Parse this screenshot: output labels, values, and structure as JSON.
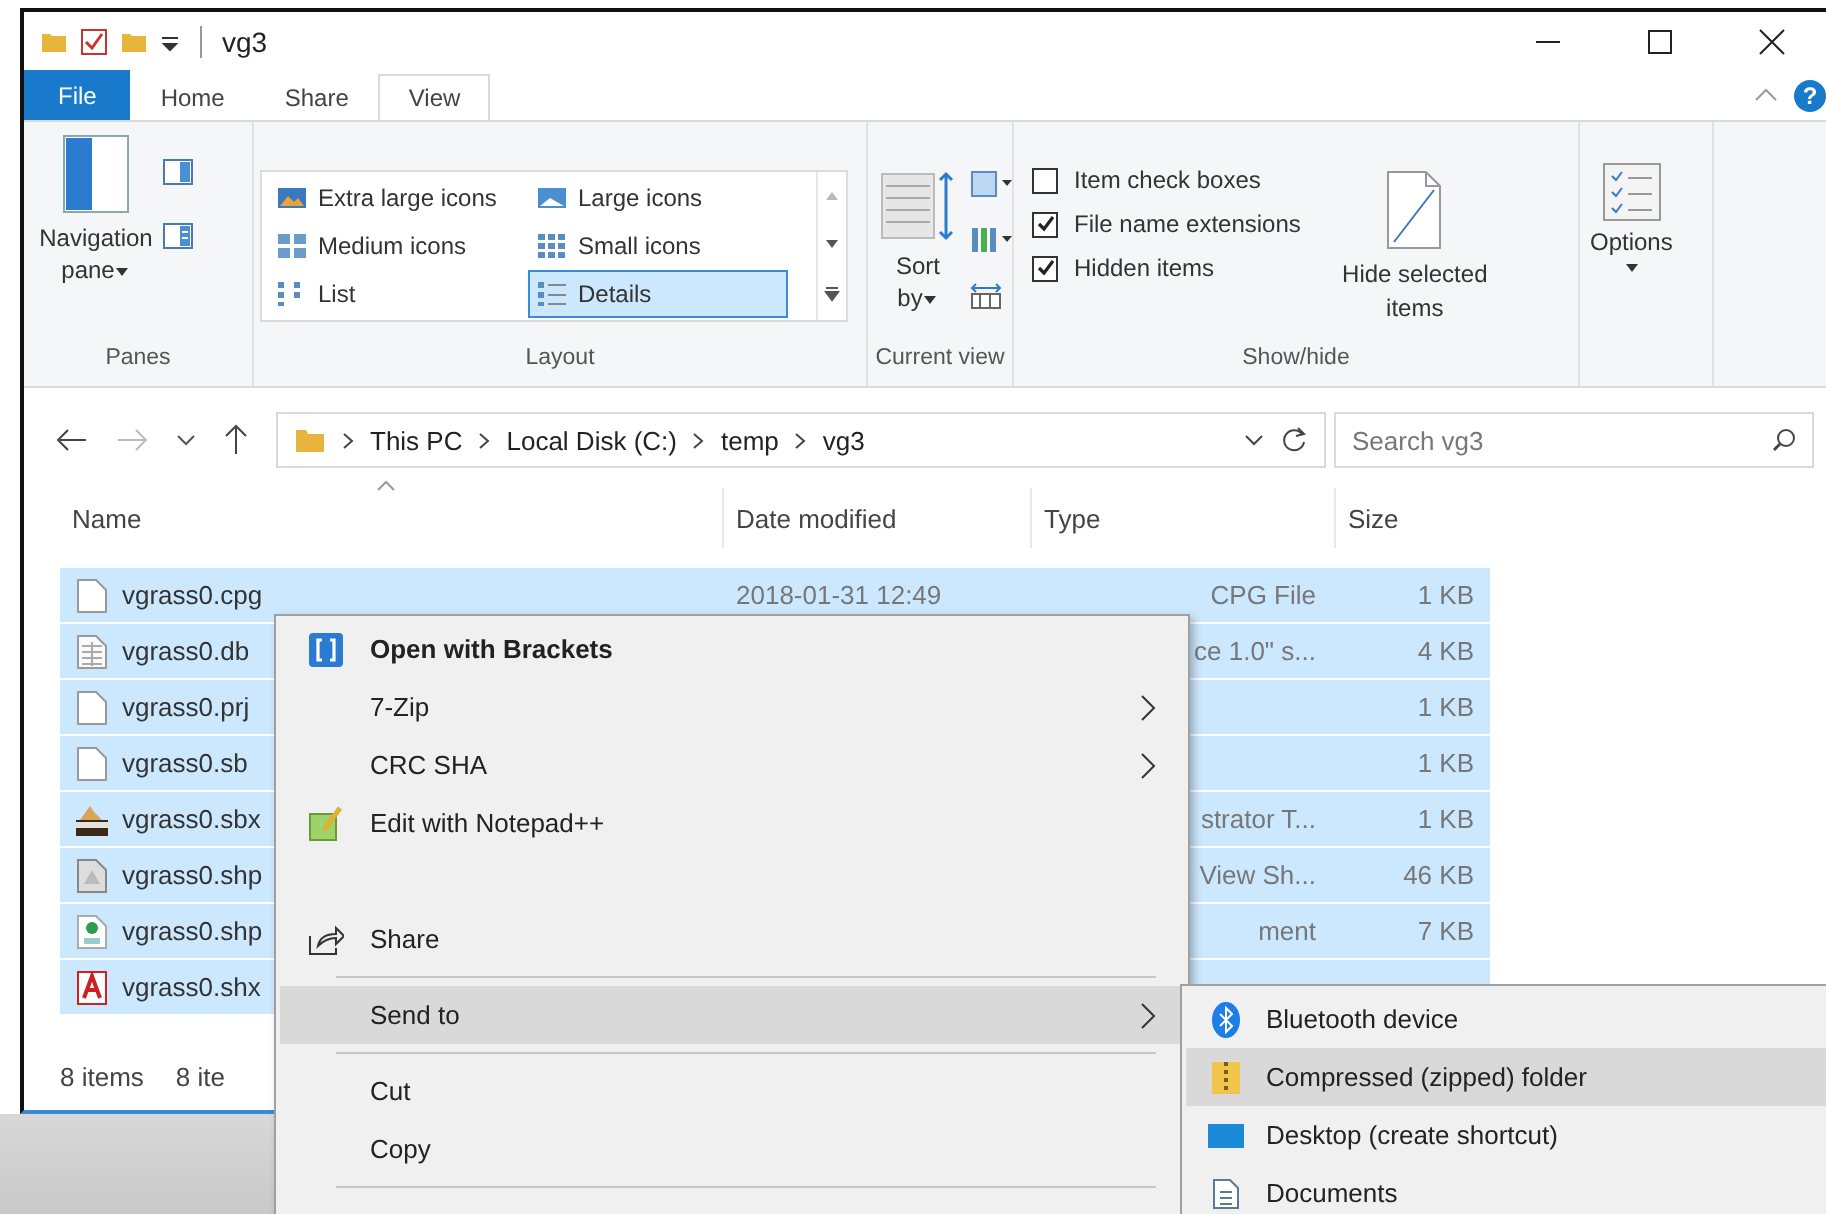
{
  "title_bar": {
    "title": "vg3"
  },
  "ribbon_tabs": [
    {
      "label": "File",
      "kind": "file",
      "selected": false
    },
    {
      "label": "Home",
      "kind": "tab",
      "selected": false
    },
    {
      "label": "Share",
      "kind": "tab",
      "selected": false
    },
    {
      "label": "View",
      "kind": "tab",
      "selected": true
    }
  ],
  "help": "?",
  "ribbon": {
    "panes": {
      "label": "Panes",
      "navigation_pane": "Navigation pane"
    },
    "layout": {
      "label": "Layout",
      "options": [
        {
          "label": "Extra large icons",
          "kind": "xl",
          "selected": false
        },
        {
          "label": "Large icons",
          "kind": "large",
          "selected": false
        },
        {
          "label": "Medium icons",
          "kind": "medium",
          "selected": false
        },
        {
          "label": "Small icons",
          "kind": "small",
          "selected": false
        },
        {
          "label": "List",
          "kind": "list",
          "selected": false
        },
        {
          "label": "Details",
          "kind": "details",
          "selected": true
        }
      ]
    },
    "current_view": {
      "label": "Current view",
      "sort_by": "Sort by"
    },
    "show_hide": {
      "label": "Show/hide",
      "checkboxes": [
        {
          "label": "Item check boxes",
          "checked": false
        },
        {
          "label": "File name extensions",
          "checked": true
        },
        {
          "label": "Hidden items",
          "checked": true
        }
      ],
      "hide_selected": "Hide selected items"
    },
    "options": {
      "label": "Options"
    }
  },
  "address": {
    "path": [
      "This PC",
      "Local Disk (C:)",
      "temp",
      "vg3"
    ],
    "search_placeholder": "Search vg3"
  },
  "columns": [
    "Name",
    "Date modified",
    "Type",
    "Size"
  ],
  "rows": [
    {
      "name": "vgrass0.cpg",
      "kind": "blank",
      "date": "2018-01-31 12:49",
      "type": "CPG File",
      "size": "1 KB",
      "selected": true
    },
    {
      "name": "vgrass0.db",
      "kind": "table",
      "type": "ce 1.0\" s...",
      "size": "4 KB",
      "selected": true
    },
    {
      "name": "vgrass0.prj",
      "kind": "blank",
      "size": "1 KB",
      "selected": true
    },
    {
      "name": "vgrass0.sb",
      "kind": "blank",
      "size": "1 KB",
      "selected": true
    },
    {
      "name": "vgrass0.sbx",
      "kind": "image",
      "type": "strator T...",
      "size": "1 KB",
      "selected": true
    },
    {
      "name": "vgrass0.shp",
      "kind": "doc",
      "type": "View Sh...",
      "size": "46 KB",
      "selected": true
    },
    {
      "name": "vgrass0.shp",
      "kind": "map",
      "type": "ment",
      "size": "7 KB",
      "selected": true
    },
    {
      "name": "vgrass0.shx",
      "kind": "pdf",
      "selected": true
    }
  ],
  "status_bar": {
    "count": "8 items",
    "selection": "8 ite"
  },
  "context_menu": [
    {
      "kind": "default",
      "label": "Open with Brackets",
      "selected": false
    },
    {
      "kind": "submenu",
      "label": "7-Zip",
      "selected": false
    },
    {
      "kind": "submenu",
      "label": "CRC SHA",
      "selected": false
    },
    {
      "kind": "notepad",
      "label": "Edit with Notepad++",
      "selected": false
    },
    {
      "kind": "blank"
    },
    {
      "kind": "share",
      "label": "Share",
      "selected": false
    },
    {
      "kind": "separator"
    },
    {
      "kind": "submenu",
      "label": "Send to",
      "selected": true
    },
    {
      "kind": "separator"
    },
    {
      "kind": "command",
      "label": "Cut",
      "selected": false
    },
    {
      "kind": "command",
      "label": "Copy",
      "selected": false
    },
    {
      "kind": "separator"
    }
  ],
  "send_to_menu": [
    {
      "label": "Bluetooth device",
      "kind": "bluetooth",
      "selected": false
    },
    {
      "label": "Compressed (zipped) folder",
      "kind": "zip",
      "selected": true
    },
    {
      "label": "Desktop (create shortcut)",
      "kind": "desktop",
      "selected": false
    },
    {
      "label": "Documents",
      "kind": "documents",
      "selected": false
    }
  ]
}
